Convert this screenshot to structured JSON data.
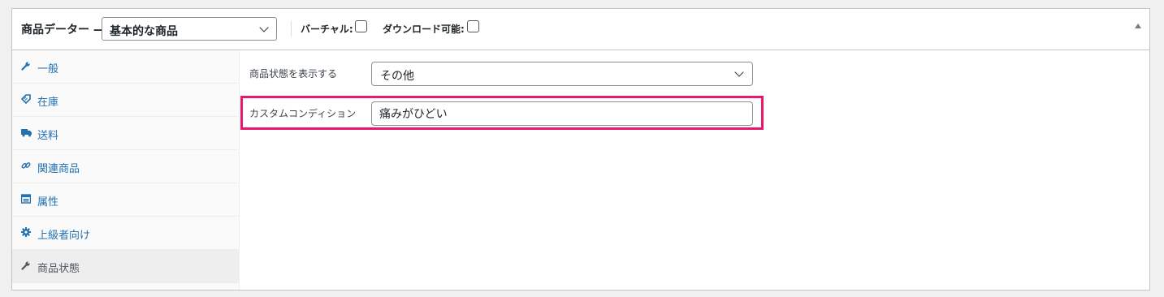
{
  "header": {
    "title": "商品データー —",
    "product_type": "基本的な商品",
    "virtual_label": "バーチャル:",
    "downloadable_label": "ダウンロード可能:",
    "virtual_checked": false,
    "downloadable_checked": false
  },
  "sidebar": {
    "items": [
      {
        "label": "一般",
        "icon": "wrench-icon"
      },
      {
        "label": "在庫",
        "icon": "tag-icon"
      },
      {
        "label": "送料",
        "icon": "truck-icon"
      },
      {
        "label": "関連商品",
        "icon": "link-icon"
      },
      {
        "label": "属性",
        "icon": "list-icon"
      },
      {
        "label": "上級者向け",
        "icon": "gear-icon"
      },
      {
        "label": "商品状態",
        "icon": "wrench-icon",
        "active": true
      }
    ]
  },
  "content": {
    "condition_label": "商品状態を表示する",
    "condition_value": "その他",
    "custom_label": "カスタムコンディション",
    "custom_value": "痛みがひどい"
  },
  "colors": {
    "link": "#2271b1",
    "highlight": "#e8196d"
  }
}
